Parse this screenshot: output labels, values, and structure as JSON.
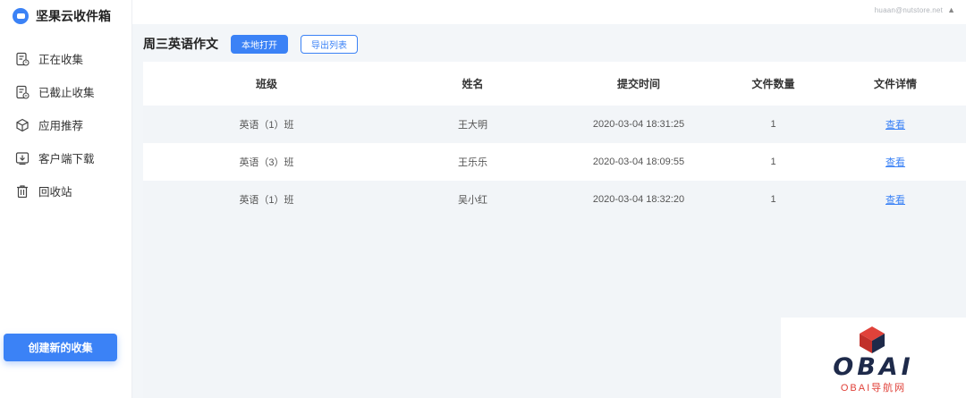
{
  "app": {
    "name": "坚果云收件箱"
  },
  "sidebar": {
    "items": [
      {
        "label": "正在收集",
        "icon": "collecting-icon"
      },
      {
        "label": "已截止收集",
        "icon": "closed-collection-icon"
      },
      {
        "label": "应用推荐",
        "icon": "cube-icon"
      },
      {
        "label": "客户端下载",
        "icon": "download-icon"
      },
      {
        "label": "回收站",
        "icon": "trash-icon"
      }
    ],
    "create_button": "创建新的收集"
  },
  "header": {
    "user_email": "huaan@nutstore.net",
    "caret": "▲"
  },
  "main": {
    "title": "周三英语作文",
    "open_local_button": "本地打开",
    "export_list_button": "导出列表"
  },
  "table": {
    "columns": [
      "班级",
      "姓名",
      "提交时间",
      "文件数量",
      "文件详情"
    ],
    "rows": [
      {
        "class": "英语（1）班",
        "name": "王大明",
        "time": "2020-03-04 18:31:25",
        "count": "1",
        "detail": "查看"
      },
      {
        "class": "英语（3）班",
        "name": "王乐乐",
        "time": "2020-03-04 18:09:55",
        "count": "1",
        "detail": "查看"
      },
      {
        "class": "英语（1）班",
        "name": "吴小红",
        "time": "2020-03-04 18:32:20",
        "count": "1",
        "detail": "查看"
      }
    ]
  },
  "watermark": {
    "brand": "OBAI",
    "sub": "OBAI导航网"
  },
  "colors": {
    "accent": "#3b82f6",
    "watermark_red": "#e0423a",
    "watermark_navy": "#1e2a4a"
  }
}
